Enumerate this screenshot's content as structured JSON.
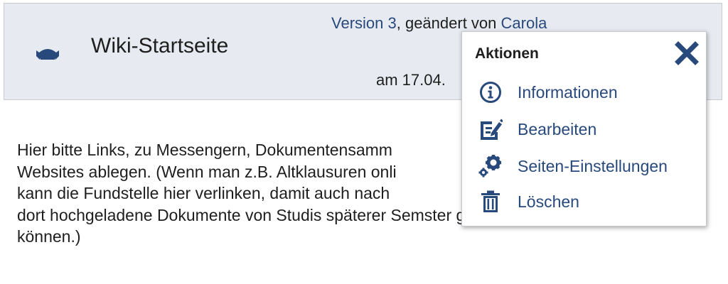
{
  "header": {
    "title": "Wiki-Startseite",
    "version_link": "Version 3",
    "changed_by_text": ", geändert von ",
    "author_link": "Carola",
    "date_text": "am 17.04."
  },
  "body": {
    "lines": [
      "Hier bitte Links, zu Messengern, Dokumentensamm",
      "Websites ablegen. (Wenn man z.B. Altklausuren onli",
      "kann die Fundstelle hier verlinken, damit auch nach",
      "dort hochgeladene Dokumente von Studis späterer Semster gefunden werden",
      "können.)"
    ]
  },
  "actions_menu": {
    "title": "Aktionen",
    "close_icon": "close-icon",
    "items": [
      {
        "label": "Informationen",
        "icon": "info-icon"
      },
      {
        "label": "Bearbeiten",
        "icon": "edit-icon"
      },
      {
        "label": "Seiten-Einstellungen",
        "icon": "settings-icon"
      },
      {
        "label": "Löschen",
        "icon": "trash-icon"
      }
    ]
  },
  "colors": {
    "link": "#28497c",
    "header_bg": "#e7ebf1",
    "text": "#1e1e1e"
  }
}
